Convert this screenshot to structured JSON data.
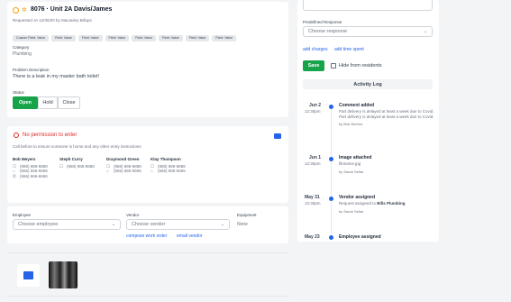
{
  "job": {
    "title": "8076 · Unit 2A Davis/James",
    "requested": "Requested on 12/30/20 by Macauley Billups",
    "fields": [
      "Custom Field: Value",
      "Field: Value",
      "Field: Value",
      "Field: Value",
      "Field: Value",
      "Field: Value",
      "Field: Value",
      "Field: Value"
    ],
    "category_label": "Category",
    "category": "Plumbing",
    "problem_label": "Problem Description",
    "problem": "There is a leak in my master bath toilet!",
    "status_label": "Status",
    "status_options": [
      "Open",
      "Hold",
      "Close"
    ]
  },
  "permission": {
    "title": "No permission to enter",
    "note": "Call before to ensure someone is home and any other entry instructions",
    "contacts": [
      {
        "name": "Bob Meyers",
        "lines": [
          "(888) 888-8888",
          "(555) 555-5555",
          "(666) 666-6666"
        ]
      },
      {
        "name": "Steph Curry",
        "lines": [
          "(888) 888-8888"
        ]
      },
      {
        "name": "Draymond Green",
        "lines": [
          "(888) 888-8888",
          "(555) 555-5555"
        ]
      },
      {
        "name": "Klay Thompson",
        "lines": [
          "(888) 888-8888",
          "(555) 555-5555"
        ]
      }
    ]
  },
  "assign": {
    "employee_label": "Employee",
    "employee_placeholder": "Choose employee",
    "vendor_label": "Vendor",
    "vendor_placeholder": "Choose vendor",
    "equipment_label": "Equipment",
    "equipment_value": "None",
    "compose_link": "compose work order",
    "email_link": "email vendor"
  },
  "right": {
    "predefined_label": "Predefined Response",
    "predefined_placeholder": "Choose response",
    "add_charges": "add charges",
    "add_time": "add time spent",
    "save": "Save",
    "hide_label": "Hide from residents",
    "activity_title": "Activity Log"
  },
  "activity": [
    {
      "date": "Jun 2",
      "time": "12:30pm",
      "title": "Comment added",
      "body": "Part delivery is delayed at least a week due to Covid. Part delivery is delayed at least a week due to Covid.",
      "by": "by Bob McGee"
    },
    {
      "date": "Jun 1",
      "time": "12:30pm",
      "title": "Image attached",
      "body": "filename.jpg",
      "by": "by Sarah Sellar"
    },
    {
      "date": "May 31",
      "time": "12:30pm",
      "title": "Vendor assigned",
      "body": "Request assigned to",
      "body_bold": "Bills Plumbing",
      "by": "by Sarah Sellar"
    },
    {
      "date": "May 23",
      "time": "",
      "title": "Employee assigned",
      "body": "",
      "by": ""
    }
  ],
  "colors": {
    "accent": "#16a34a",
    "link": "#2563eb",
    "alert": "#dc2626",
    "warning": "#f59e0b"
  }
}
